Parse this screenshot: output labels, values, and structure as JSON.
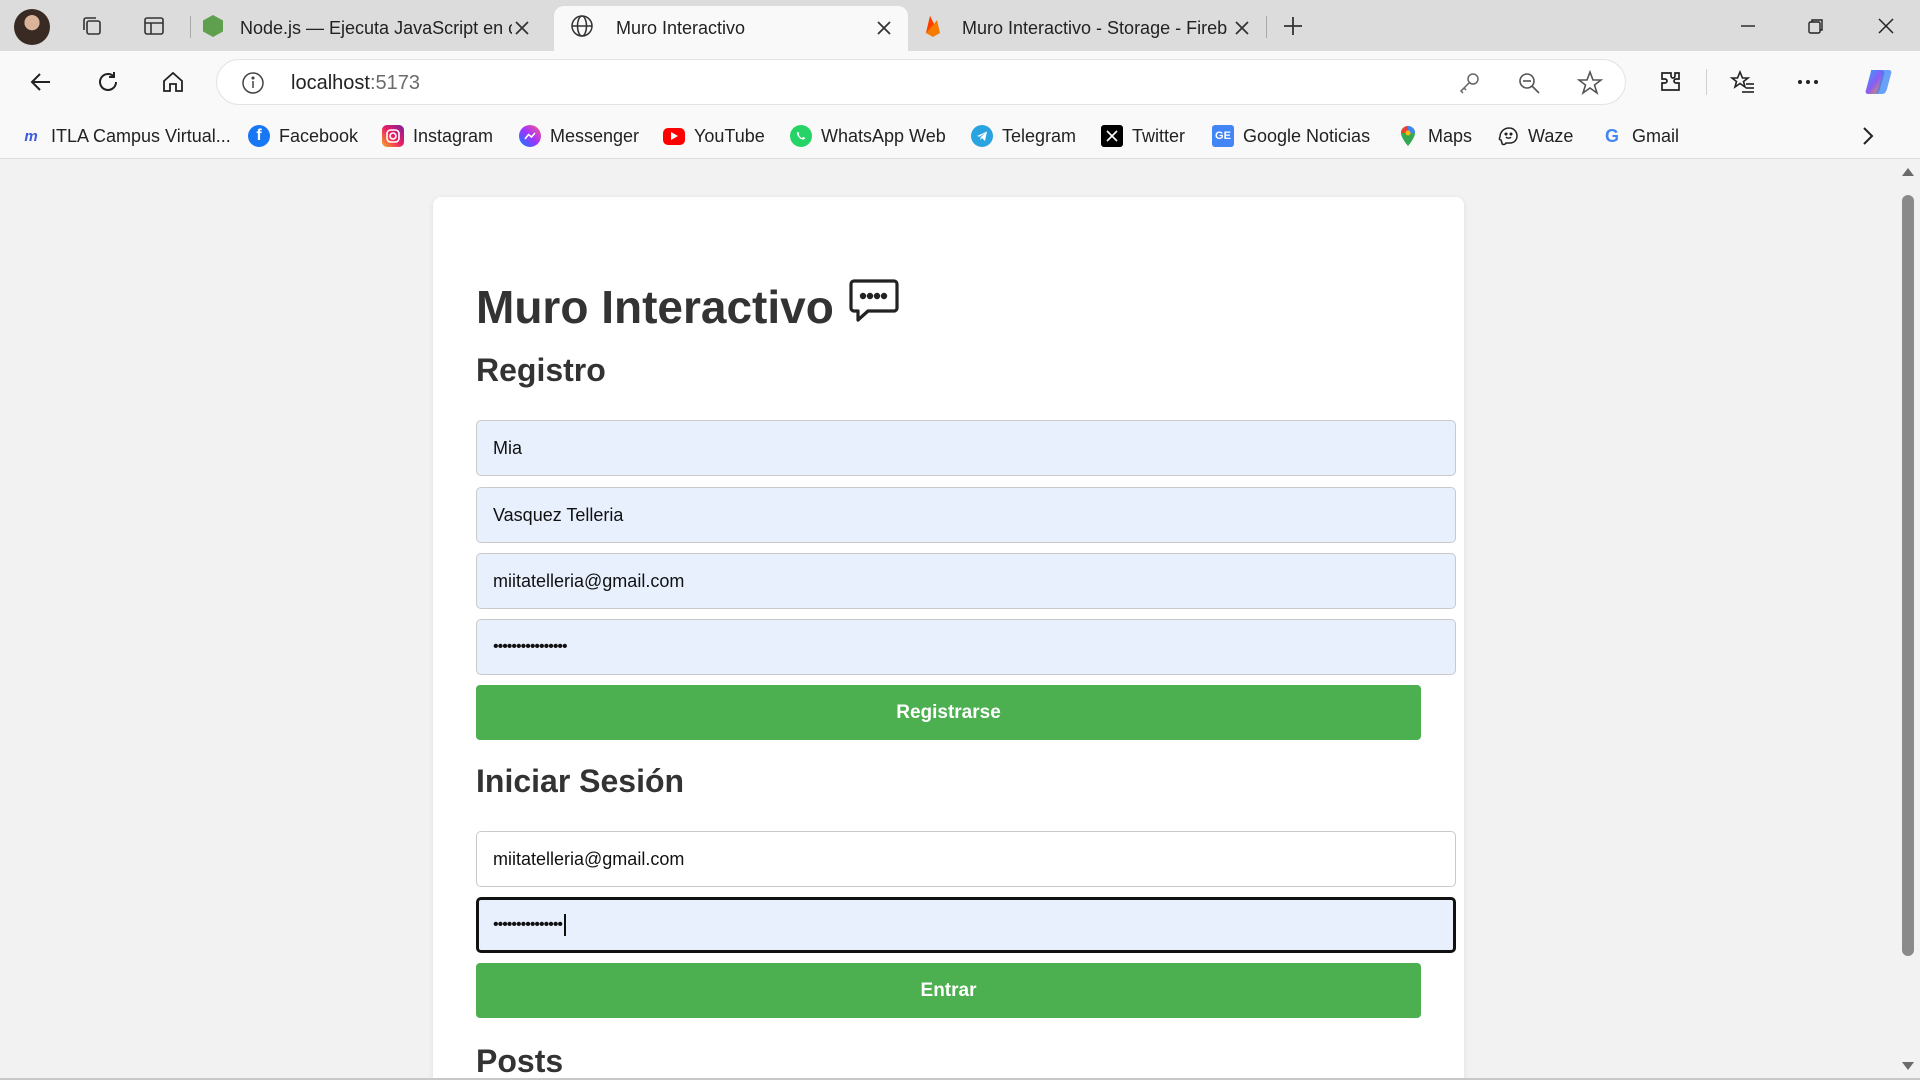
{
  "browser": {
    "tabs": [
      {
        "title": "Node.js — Ejecuta JavaScript en c",
        "icon": "nodejs-icon",
        "active": false
      },
      {
        "title": "Muro Interactivo",
        "icon": "globe-icon",
        "active": true
      },
      {
        "title": "Muro Interactivo - Storage - Fireb",
        "icon": "firebase-icon",
        "active": false
      }
    ],
    "url_host": "localhost",
    "url_port": ":5173",
    "bookmarks": [
      {
        "label": "ITLA Campus Virtual...",
        "icon": "itla-icon"
      },
      {
        "label": "Facebook",
        "icon": "facebook-icon"
      },
      {
        "label": "Instagram",
        "icon": "instagram-icon"
      },
      {
        "label": "Messenger",
        "icon": "messenger-icon"
      },
      {
        "label": "YouTube",
        "icon": "youtube-icon"
      },
      {
        "label": "WhatsApp Web",
        "icon": "whatsapp-icon"
      },
      {
        "label": "Telegram",
        "icon": "telegram-icon"
      },
      {
        "label": "Twitter",
        "icon": "x-twitter-icon"
      },
      {
        "label": "Google Noticias",
        "icon": "google-news-icon"
      },
      {
        "label": "Maps",
        "icon": "maps-icon"
      },
      {
        "label": "Waze",
        "icon": "waze-icon"
      },
      {
        "label": "Gmail",
        "icon": "google-icon"
      }
    ]
  },
  "page": {
    "title": "Muro Interactivo",
    "title_icon": "speech-bubble-icon",
    "register": {
      "heading": "Registro",
      "first_name": "Mia",
      "last_name": "Vasquez Telleria",
      "email": "miitatelleria@gmail.com",
      "password_mask": "••••••••••••••••",
      "button": "Registrarse"
    },
    "login": {
      "heading": "Iniciar Sesión",
      "email": "miitatelleria@gmail.com",
      "password_mask": "•••••••••••••••",
      "button": "Entrar"
    },
    "posts_heading": "Posts"
  },
  "colors": {
    "accent_button": "#4caf50",
    "autofill_bg": "#e8f0fe"
  }
}
